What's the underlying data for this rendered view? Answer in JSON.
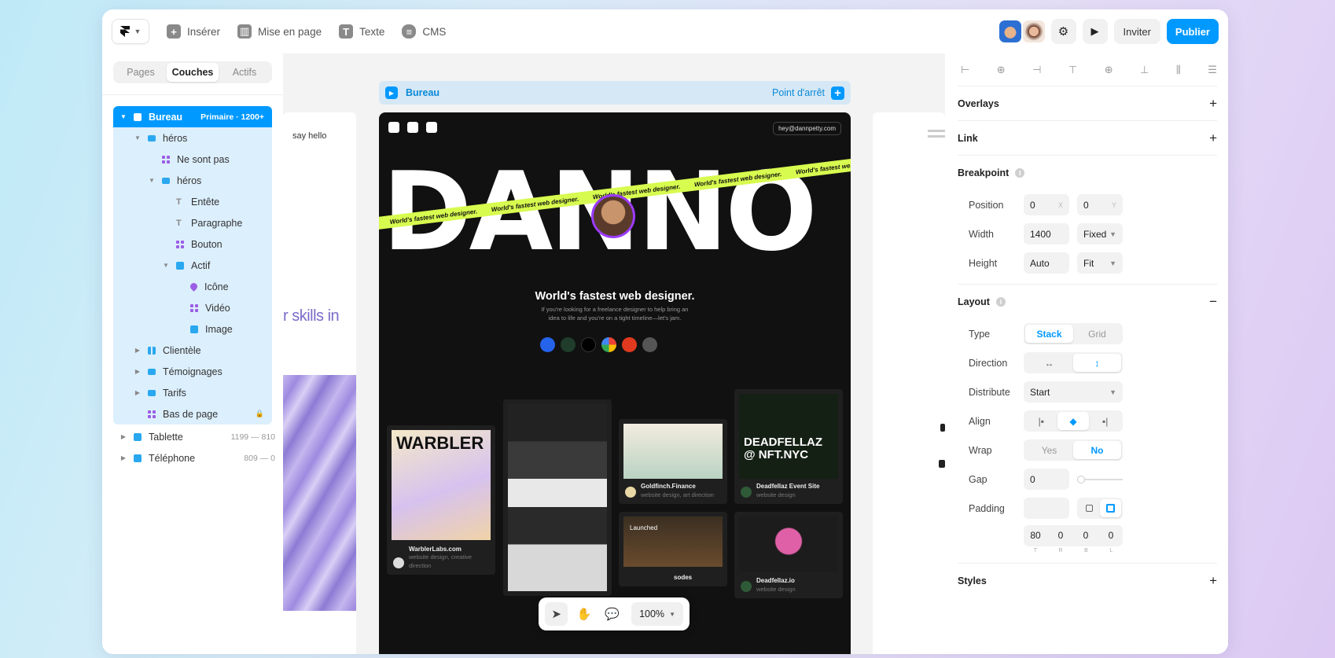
{
  "topbar": {
    "menu": [
      {
        "label": "Insérer",
        "icon": "plus-icon"
      },
      {
        "label": "Mise en page",
        "icon": "layout-icon"
      },
      {
        "label": "Texte",
        "icon": "text-icon"
      },
      {
        "label": "CMS",
        "icon": "database-icon"
      }
    ],
    "invite_label": "Inviter",
    "publish_label": "Publier"
  },
  "left": {
    "tabs": [
      "Pages",
      "Couches",
      "Actifs"
    ],
    "active_tab": "Couches",
    "layers": [
      {
        "label": "Bureau",
        "meta": "Primaire · 1200+"
      },
      {
        "label": "héros"
      },
      {
        "label": "Ne sont pas"
      },
      {
        "label": "héros"
      },
      {
        "label": "Entête"
      },
      {
        "label": "Paragraphe"
      },
      {
        "label": "Bouton"
      },
      {
        "label": "Actif"
      },
      {
        "label": "Icône"
      },
      {
        "label": "Vidéo"
      },
      {
        "label": "Image"
      },
      {
        "label": "Clientèle"
      },
      {
        "label": "Témoignages"
      },
      {
        "label": "Tarifs"
      },
      {
        "label": "Bas de page"
      },
      {
        "label": "Tablette",
        "meta": "1199 — 810"
      },
      {
        "label": "Téléphone",
        "meta": "809 — 0"
      }
    ]
  },
  "canvas": {
    "breakpoint_label": "Bureau",
    "breakpoint_action": "Point d'arrêt",
    "left_frame_text": "say hello",
    "left_frame_big": "r skills in",
    "preview": {
      "email": "hey@dannpetty.com",
      "big_text": "DANNO",
      "ribbon_text": "World's fastest web designer.",
      "headline": "World's fastest web designer.",
      "paragraph": "If you're looking for a freelance designer to help bring an idea to life and you're on a tight timeline—let's jam.",
      "cards": [
        {
          "title": "WarblerLabs.com",
          "sub": "website design, creative direction",
          "thumb_text": "WARBLER"
        },
        {
          "title": "Goldfinch.Finance",
          "sub": "website design, art direction"
        },
        {
          "title": "Deadfellaz Event Site",
          "sub": "website design",
          "thumb_text": "DEADFELLAZ @ NFT.NYC"
        },
        {
          "title": "Deadfellaz.io",
          "sub": "website design"
        },
        {
          "title": "Launched",
          "sub": "sodes"
        }
      ]
    },
    "zoom": "100%"
  },
  "right": {
    "sections": {
      "overlays": "Overlays",
      "link": "Link",
      "breakpoint": "Breakpoint",
      "layout": "Layout",
      "styles": "Styles"
    },
    "position": {
      "label": "Position",
      "x": "0",
      "y": "0",
      "x_hint": "X",
      "y_hint": "Y"
    },
    "width": {
      "label": "Width",
      "value": "1400",
      "mode": "Fixed"
    },
    "height": {
      "label": "Height",
      "value": "Auto",
      "mode": "Fit"
    },
    "type": {
      "label": "Type",
      "options": [
        "Stack",
        "Grid"
      ],
      "active": "Stack"
    },
    "direction": {
      "label": "Direction"
    },
    "distribute": {
      "label": "Distribute",
      "value": "Start"
    },
    "align": {
      "label": "Align"
    },
    "wrap": {
      "label": "Wrap",
      "options": [
        "Yes",
        "No"
      ],
      "active": "No"
    },
    "gap": {
      "label": "Gap",
      "value": "0"
    },
    "padding": {
      "label": "Padding",
      "values": [
        "80",
        "0",
        "0",
        "0"
      ],
      "sides": [
        "T",
        "R",
        "B",
        "L"
      ]
    }
  }
}
